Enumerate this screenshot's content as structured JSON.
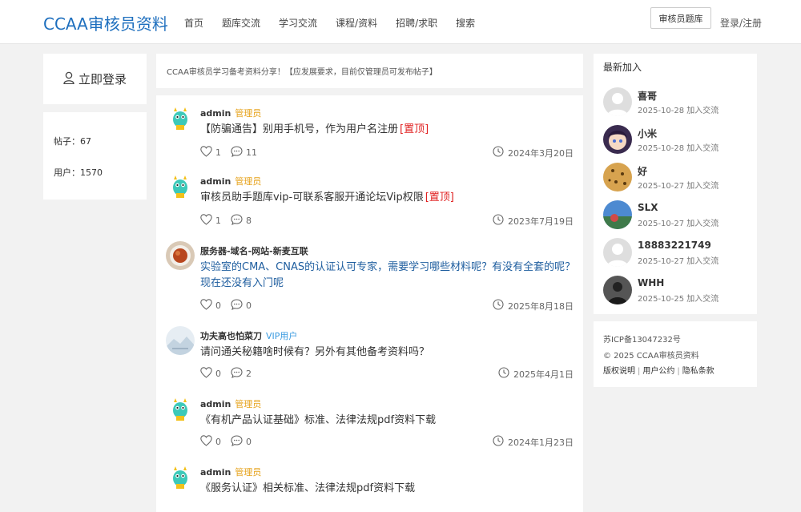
{
  "header": {
    "logo": "CCAA审核员资料",
    "nav": [
      "首页",
      "题库交流",
      "学习交流",
      "课程/资料",
      "招聘/求职",
      "搜索"
    ],
    "bank_button": "审核员题库",
    "login_link": "登录/注册"
  },
  "left": {
    "login_label": "立即登录",
    "stats": [
      {
        "label": "帖子：67"
      },
      {
        "label": "用户：1570"
      }
    ]
  },
  "notice": "CCAA审核员学习备考资料分享！【应发展要求，目前仅管理员可发布帖子】",
  "posts": [
    {
      "author": "admin",
      "role": "管理员",
      "title": "【防骗通告】别用手机号，作为用户名注册",
      "pin": "[置顶]",
      "likes": "1",
      "comments": "11",
      "date": "2024年3月20日"
    },
    {
      "author": "admin",
      "role": "管理员",
      "title": "审核员助手题库vip-可联系客服开通论坛Vip权限",
      "pin": "[置顶]",
      "likes": "1",
      "comments": "8",
      "date": "2023年7月19日"
    },
    {
      "author": "服务器-域名-网站-新麦互联",
      "role": "",
      "title": "实验室的CMA、CNAS的认证认可专家，需要学习哪些材料呢？有没有全套的呢？现在还没有入门呢",
      "pin": "",
      "likes": "0",
      "comments": "0",
      "date": "2025年8月18日"
    },
    {
      "author": "功夫高也怕菜刀",
      "role": "VIP用户",
      "title": "请问通关秘籍啥时候有？另外有其他备考资料吗？",
      "pin": "",
      "likes": "0",
      "comments": "2",
      "date": "2025年4月1日"
    },
    {
      "author": "admin",
      "role": "管理员",
      "title": "《有机产品认证基础》标准、法律法规pdf资料下载",
      "pin": "",
      "likes": "0",
      "comments": "0",
      "date": "2024年1月23日"
    },
    {
      "author": "admin",
      "role": "管理员",
      "title": "《服务认证》相关标准、法律法规pdf资料下载",
      "pin": "",
      "likes": "",
      "comments": "",
      "date": ""
    }
  ],
  "latest": {
    "title": "最新加入",
    "members": [
      {
        "name": "喜哥",
        "date": "2025-10-28 加入交流"
      },
      {
        "name": "小米",
        "date": "2025-10-28 加入交流"
      },
      {
        "name": "好",
        "date": "2025-10-27 加入交流"
      },
      {
        "name": "SLX",
        "date": "2025-10-27 加入交流"
      },
      {
        "name": "18883221749",
        "date": "2025-10-27 加入交流"
      },
      {
        "name": "WHH",
        "date": "2025-10-25 加入交流"
      }
    ]
  },
  "footer": {
    "icp": "苏ICP备13047232号",
    "copyright": "© 2025 CCAA审核员资料",
    "links": [
      "版权说明",
      "用户公约",
      "隐私条款"
    ]
  },
  "colors": {
    "brand": "#1e6fbe",
    "admin_role": "#e6a21b",
    "vip_role": "#3a9be0",
    "pin": "#e02020"
  }
}
